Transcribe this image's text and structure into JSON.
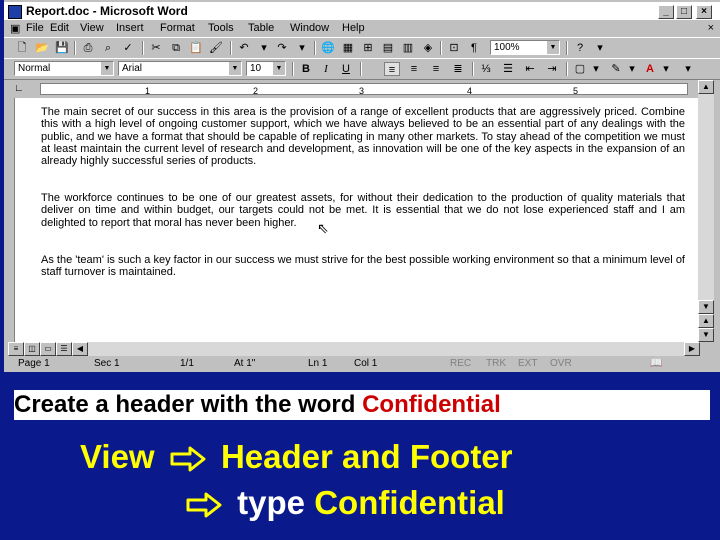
{
  "window": {
    "title": "Report.doc - Microsoft Word",
    "controls": {
      "minimize": "_",
      "maximize": "□",
      "close": "×"
    }
  },
  "menu": {
    "items": [
      "File",
      "Edit",
      "View",
      "Insert",
      "Format",
      "Tools",
      "Table",
      "Window",
      "Help"
    ],
    "close_doc": "×"
  },
  "toolbar": {
    "zoom": "100%",
    "style": "Normal",
    "font": "Arial",
    "size": "10",
    "bold": "B",
    "italic": "I",
    "underline": "U",
    "paragraph_mark": "¶",
    "help": "?"
  },
  "ruler": {
    "numbers": [
      "1",
      "2",
      "3",
      "4",
      "5"
    ]
  },
  "document": {
    "paragraphs": [
      "The main secret of our success in this area is the provision of a range of excellent products that are aggressively priced. Combine this with a high level of ongoing customer support, which we have always believed to be an essential part of any dealings with the public, and we have a format that should be capable of replicating in many other markets. To stay ahead of the competition we must at least maintain the current level of research and development, as innovation will be one of the key aspects in the expansion of an already highly successful series of products.",
      "The workforce continues to be one of our greatest assets, for without their dedication to the production of quality materials that deliver on time and within budget, our targets could not be met. It is essential that we do not lose experienced staff and I am delighted to report that moral has never been higher.",
      "As the 'team' is such a key factor in our success we must strive for the best possible working environment so that a minimum level of staff turnover is maintained."
    ]
  },
  "status": {
    "page": "Page 1",
    "sec": "Sec 1",
    "pages": "1/1",
    "at": "At 1\"",
    "ln": "Ln 1",
    "col": "Col 1",
    "rec": "REC",
    "trk": "TRK",
    "ext": "EXT",
    "ovr": "OVR"
  },
  "instruction": {
    "caption_black": "Create a header with the word ",
    "caption_red": "Confidential",
    "step1_a": "View",
    "step1_b": "Header and Footer",
    "step2_a": "type",
    "step2_b": "Confidential"
  },
  "colors": {
    "background": "#0a1a8c",
    "accent_yellow": "#ffff00",
    "caption_red": "#cc0000"
  }
}
